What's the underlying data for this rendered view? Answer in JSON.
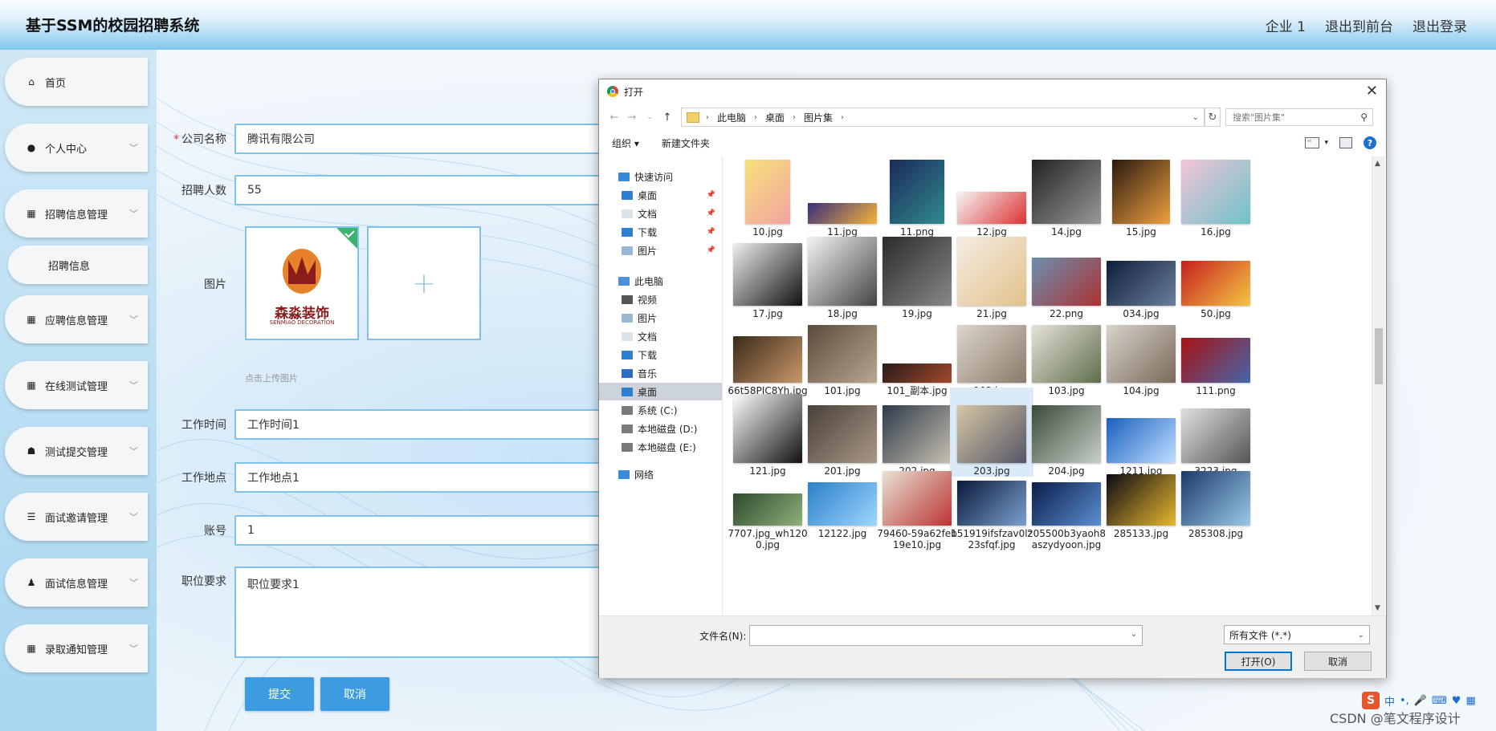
{
  "header": {
    "title": "基于SSM的校园招聘系统",
    "nav": [
      "企业 1",
      "退出到前台",
      "退出登录"
    ]
  },
  "sidebar": {
    "items": [
      {
        "icon": "home-icon",
        "label": "首页"
      },
      {
        "icon": "user-icon",
        "label": "个人中心"
      },
      {
        "icon": "grid-icon",
        "label": "招聘信息管理"
      },
      {
        "icon": "",
        "label": "招聘信息"
      },
      {
        "icon": "grid-icon",
        "label": "应聘信息管理"
      },
      {
        "icon": "grid-icon",
        "label": "在线测试管理"
      },
      {
        "icon": "thumb-icon",
        "label": "测试提交管理"
      },
      {
        "icon": "list-icon",
        "label": "面试邀请管理"
      },
      {
        "icon": "person-icon",
        "label": "面试信息管理"
      },
      {
        "icon": "grid-icon",
        "label": "录取通知管理"
      }
    ]
  },
  "form": {
    "company_label": "公司名称",
    "company_value": "腾讯有限公司",
    "count_label": "招聘人数",
    "count_value": "55",
    "image_label": "图片",
    "upload_hint": "点击上传图片",
    "logo_text": "森淼装饰",
    "logo_sub": "SENMIAO DECORATION",
    "time_label": "工作时间",
    "time_value": "工作时间1",
    "place_label": "工作地点",
    "place_value": "工作地点1",
    "account_label": "账号",
    "account_value": "1",
    "req_label": "职位要求",
    "req_value": "职位要求1",
    "submit": "提交",
    "cancel": "取消"
  },
  "dialog": {
    "title": "打开",
    "path": [
      "此电脑",
      "桌面",
      "图片集"
    ],
    "search_placeholder": "搜索\"图片集\"",
    "organize": "组织 ▾",
    "new_folder": "新建文件夹",
    "nav": [
      {
        "label": "快速访问",
        "icon": "star-icon",
        "pin": false
      },
      {
        "label": "桌面",
        "icon": "desktop-icon",
        "pin": true
      },
      {
        "label": "文档",
        "icon": "doc-icon",
        "pin": true
      },
      {
        "label": "下载",
        "icon": "download-icon",
        "pin": true
      },
      {
        "label": "图片",
        "icon": "picture-icon",
        "pin": true
      },
      {
        "label": "此电脑",
        "icon": "pc-icon",
        "pin": false
      },
      {
        "label": "视频",
        "icon": "video-icon",
        "pin": false
      },
      {
        "label": "图片",
        "icon": "picture-icon",
        "pin": false
      },
      {
        "label": "文档",
        "icon": "doc-icon",
        "pin": false
      },
      {
        "label": "下载",
        "icon": "download-icon",
        "pin": false
      },
      {
        "label": "音乐",
        "icon": "music-icon",
        "pin": false
      },
      {
        "label": "桌面",
        "icon": "desktop-icon",
        "pin": false
      },
      {
        "label": "系统 (C:)",
        "icon": "drive-icon",
        "pin": false
      },
      {
        "label": "本地磁盘 (D:)",
        "icon": "drive-icon",
        "pin": false
      },
      {
        "label": "本地磁盘 (E:)",
        "icon": "drive-icon",
        "pin": false
      },
      {
        "label": "网络",
        "icon": "network-icon",
        "pin": false
      }
    ],
    "files": [
      "10.jpg",
      "11.jpg",
      "11.png",
      "12.jpg",
      "14.jpg",
      "15.jpg",
      "16.jpg",
      "17.jpg",
      "18.jpg",
      "19.jpg",
      "21.jpg",
      "22.png",
      "034.jpg",
      "50.jpg",
      "66t58PIC8Yh.jpg",
      "101.jpg",
      "101_副本.jpg",
      "102.jpg",
      "103.jpg",
      "104.jpg",
      "111.png",
      "121.jpg",
      "201.jpg",
      "202.jpg",
      "203.jpg",
      "204.jpg",
      "1211.jpg",
      "3223.jpg",
      "7707.jpg_wh1200.jpg",
      "12122.jpg",
      "79460-59a62feb19e10.jpg",
      "151919ifsfzav0lz23sfqf.jpg",
      "205500b3yaoh8aszydyoon.jpg",
      "285133.jpg",
      "285308.jpg"
    ],
    "filename_label": "文件名(N):",
    "filter": "所有文件 (*.*)",
    "open": "打开(O)",
    "cancel": "取消"
  },
  "tray": {
    "ime": "中",
    "watermark": "CSDN @笔文程序设计"
  },
  "colors": {
    "accent": "#3d9be1",
    "border": "#7ec3ea"
  }
}
